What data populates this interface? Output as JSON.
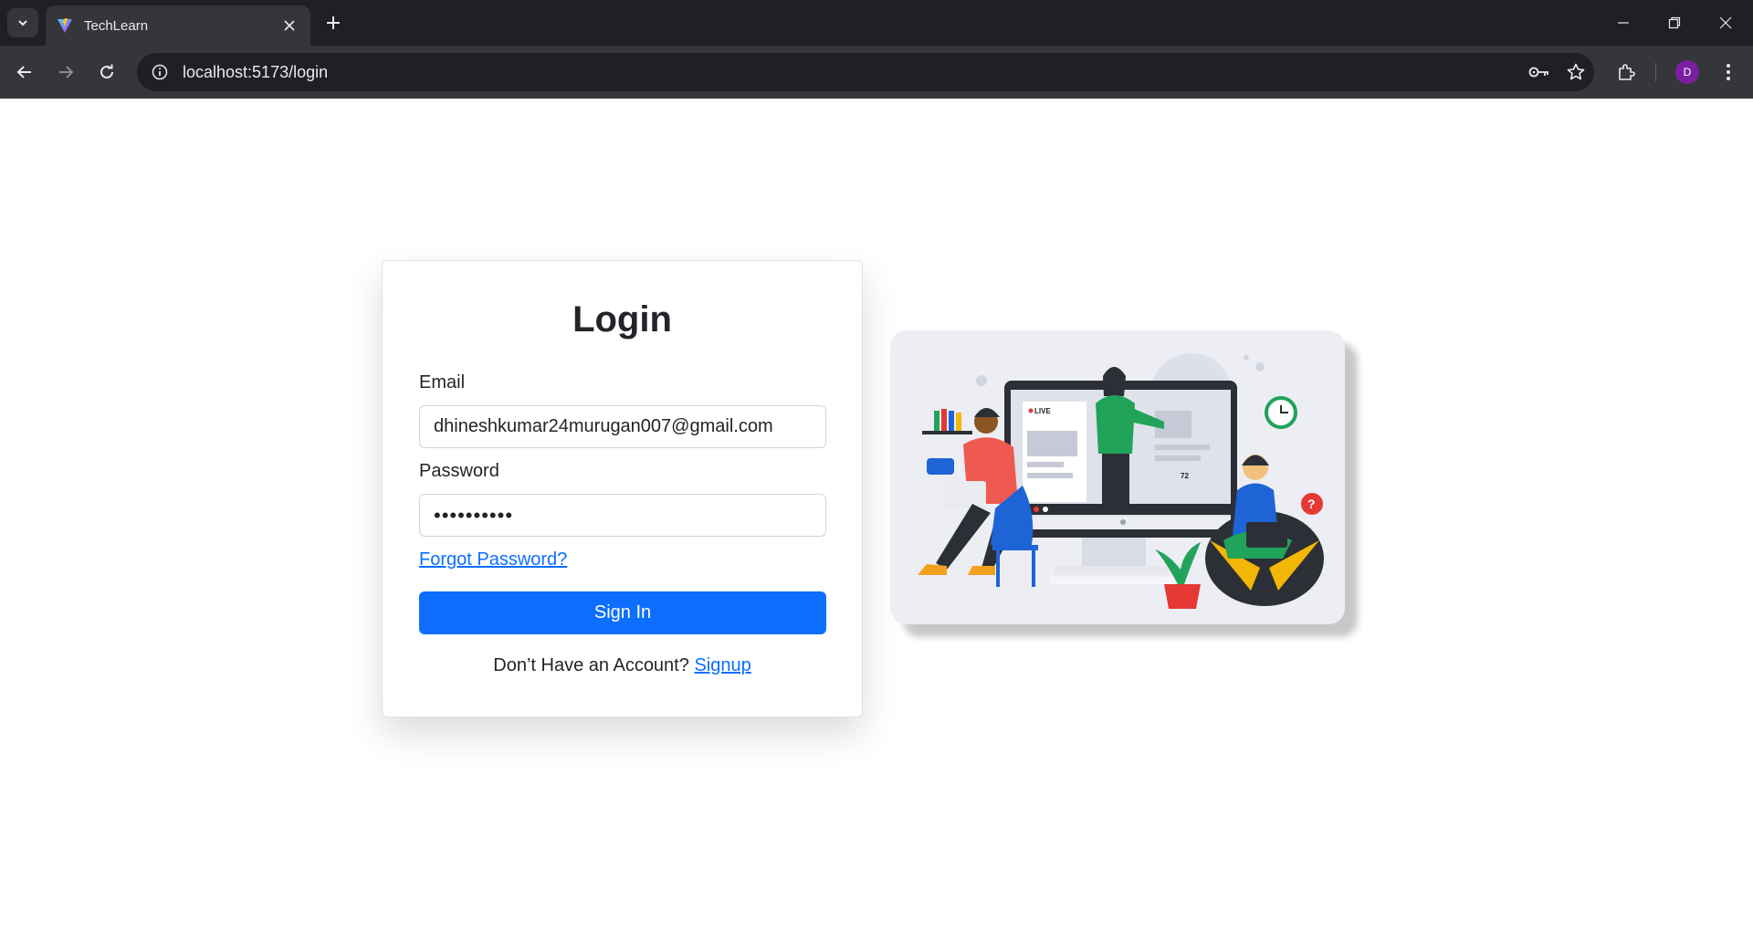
{
  "browser": {
    "tab_title": "TechLearn",
    "url": "localhost:5173/login",
    "profile_initial": "D"
  },
  "login": {
    "title": "Login",
    "email_label": "Email",
    "email_value": "dhineshkumar24murugan007@gmail.com",
    "password_label": "Password",
    "password_value": "••••••••••",
    "forgot_link": "Forgot Password?",
    "signin_button": "Sign In",
    "no_account_text": "Don’t Have an Account?",
    "signup_link": "Signup"
  },
  "illustration": {
    "live_badge": "LIVE",
    "viewer_count": "72"
  },
  "colors": {
    "primary": "#0d6efd",
    "chrome_dark": "#1f2023",
    "chrome_toolbar": "#35363a",
    "profile": "#7b1fa2"
  },
  "icons": [
    "tab-search-icon",
    "vite-logo-icon",
    "close-icon",
    "plus-icon",
    "minimize-icon",
    "restore-icon",
    "back-icon",
    "forward-icon",
    "reload-icon",
    "info-icon",
    "key-icon",
    "star-icon",
    "extensions-icon",
    "more-icon"
  ]
}
